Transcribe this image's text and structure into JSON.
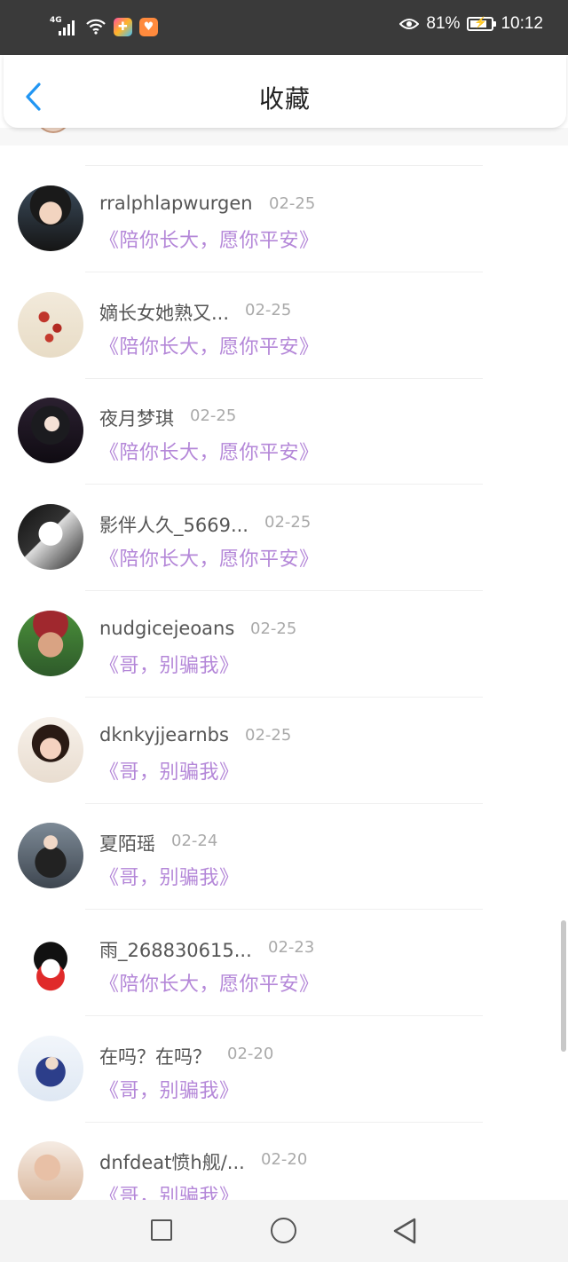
{
  "status_bar": {
    "network": "4G",
    "battery_pct": "81%",
    "battery_level": 0.81,
    "time": "10:12"
  },
  "header": {
    "title": "收藏",
    "back_icon": "chevron-left-icon"
  },
  "items": [
    {
      "name": "rralphlapwurgen",
      "date": "02-25",
      "book": "《陪你长大，愿你平安》"
    },
    {
      "name": "嫡长女她熟又...",
      "date": "02-25",
      "book": "《陪你长大，愿你平安》"
    },
    {
      "name": "夜月梦琪",
      "date": "02-25",
      "book": "《陪你长大，愿你平安》"
    },
    {
      "name": "影伴人久_5669...",
      "date": "02-25",
      "book": "《陪你长大，愿你平安》"
    },
    {
      "name": "nudgicejeoans",
      "date": "02-25",
      "book": "《哥，别骗我》"
    },
    {
      "name": "dknkyjjearnbs",
      "date": "02-25",
      "book": "《哥，别骗我》"
    },
    {
      "name": "夏陌瑶",
      "date": "02-24",
      "book": "《哥，别骗我》"
    },
    {
      "name": "雨_268830615...",
      "date": "02-23",
      "book": "《陪你长大，愿你平安》"
    },
    {
      "name": "在吗？在吗？",
      "date": "02-20",
      "book": "《哥，别骗我》"
    },
    {
      "name": "dnfdeat愤h舰/...",
      "date": "02-20",
      "book": "《哥，别骗我》"
    }
  ],
  "colors": {
    "accent": "#2196F3",
    "book_title": "#b487d8",
    "name": "#555555",
    "date": "#aaaaaa"
  },
  "nav": {
    "icons": [
      "square-icon",
      "circle-icon",
      "triangle-back-icon"
    ]
  }
}
